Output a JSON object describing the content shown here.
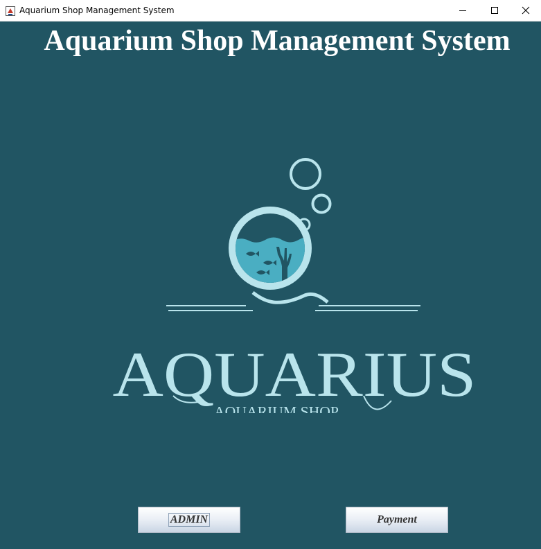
{
  "window": {
    "title": "Aquarium Shop Management System"
  },
  "header": {
    "title": "Aquarium Shop Management System"
  },
  "logo": {
    "name": "AQUARIUS",
    "tagline": "AQUARIUM SHOP",
    "icon": "fish-bowl-logo"
  },
  "buttons": {
    "admin_label": "ADMIN",
    "payment_label": "Payment"
  },
  "colors": {
    "background": "#215563",
    "logo_light": "#b9e4ec",
    "water": "#4aaec2",
    "title_text": "#ffffff"
  }
}
